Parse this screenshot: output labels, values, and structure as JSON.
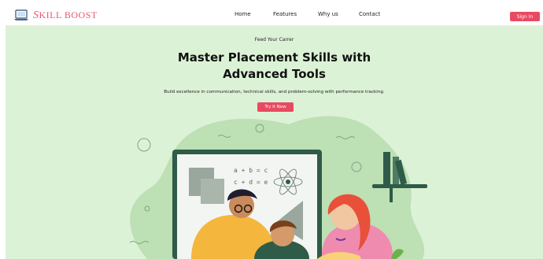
{
  "brand": {
    "initial": "S",
    "name": "KILL BOOST",
    "accent_color": "#e84a62",
    "icon": "laptop-icon"
  },
  "nav": {
    "links": [
      "Home",
      "Features",
      "Why us",
      "Contact"
    ],
    "signin_label": "Sign In"
  },
  "hero": {
    "eyebrow": "Feed Your Carrer",
    "headline_line1": "Master Placement Skills with",
    "headline_line2": "Advanced Tools",
    "subtitle": "Build excellence in communication, technical skills, and problem-solving with performance tracking.",
    "cta_label": "Try It Now",
    "background_color": "#dcf2d6"
  },
  "illustration": {
    "board_formula_1": "a + b = c",
    "board_formula_2": "c + d = e",
    "description_icon": "students-studying-illustration"
  }
}
